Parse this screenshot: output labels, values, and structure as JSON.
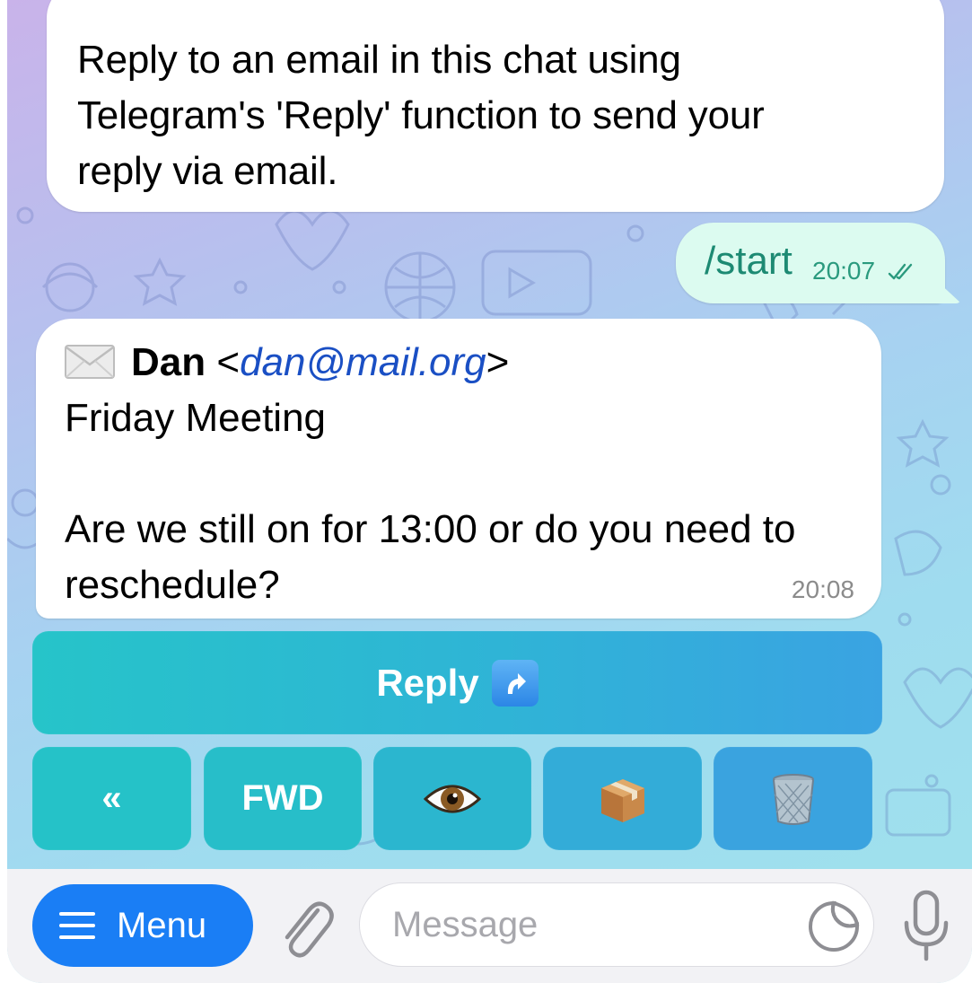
{
  "chat": {
    "intro_message": {
      "lines": [
        "Reply to an email in this chat using",
        "Telegram's 'Reply' function to send your",
        "reply via email."
      ]
    },
    "outgoing_message": {
      "text": "/start",
      "time": "20:07",
      "status": "read"
    },
    "email_message": {
      "sender_name": "Dan",
      "sender_email": "dan@mail.org",
      "subject": "Friday Meeting",
      "body_lines": [
        "Are we still on for 13:00 or do you need to",
        "reschedule?"
      ],
      "time": "20:08"
    }
  },
  "keyboard": {
    "reply_label": "Reply",
    "reply_emoji": "⤴",
    "buttons": [
      {
        "label": "«",
        "name": "back"
      },
      {
        "label": "FWD",
        "name": "forward"
      },
      {
        "label": "",
        "name": "eye-icon"
      },
      {
        "label": "",
        "name": "package-icon"
      },
      {
        "label": "",
        "name": "wastebasket-icon"
      }
    ]
  },
  "input_bar": {
    "menu_label": "Menu",
    "placeholder": "Message"
  },
  "colors": {
    "accent_blue": "#1a7ef5",
    "outgoing_bubble": "#dcfbf0",
    "outgoing_text": "#1d8a73",
    "link": "#1a4fc4"
  }
}
